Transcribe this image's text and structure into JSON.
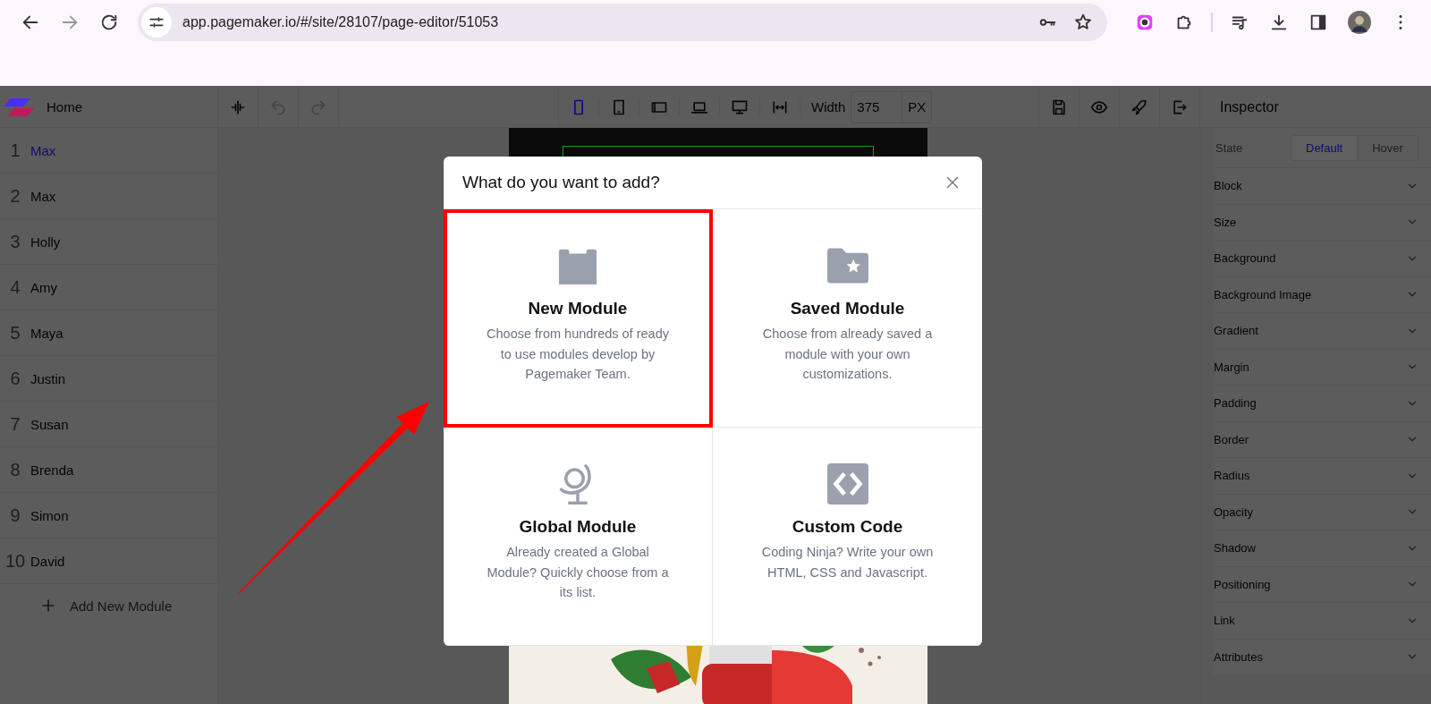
{
  "browser": {
    "nav": [
      {
        "kind": "back",
        "disabled": false
      },
      {
        "kind": "forward",
        "disabled": true
      },
      {
        "kind": "reload",
        "disabled": false
      }
    ],
    "url": "app.pagemaker.io/#/site/28107/page-editor/51053"
  },
  "toolbar": {
    "title": "Home",
    "history": [
      {
        "kind": "split",
        "disabled": false
      },
      {
        "kind": "undo",
        "disabled": true
      },
      {
        "kind": "redo",
        "disabled": true
      }
    ],
    "devices": [
      {
        "kind": "mobile",
        "selected": true
      },
      {
        "kind": "tablet",
        "selected": false
      },
      {
        "kind": "landscape",
        "selected": false
      },
      {
        "kind": "laptop",
        "selected": false
      },
      {
        "kind": "desktop",
        "selected": false
      }
    ],
    "width_label": "Width",
    "width_value": "375",
    "unit": "PX",
    "actions": [
      {
        "kind": "save"
      },
      {
        "kind": "preview"
      },
      {
        "kind": "publish"
      },
      {
        "kind": "exit"
      }
    ]
  },
  "sidebar": {
    "modules": [
      {
        "number": "1",
        "name": "Max",
        "selected": true
      },
      {
        "number": "2",
        "name": "Max",
        "selected": false
      },
      {
        "number": "3",
        "name": "Holly",
        "selected": false
      },
      {
        "number": "4",
        "name": "Amy",
        "selected": false
      },
      {
        "number": "5",
        "name": "Maya",
        "selected": false
      },
      {
        "number": "6",
        "name": "Justin",
        "selected": false
      },
      {
        "number": "7",
        "name": "Susan",
        "selected": false
      },
      {
        "number": "8",
        "name": "Brenda",
        "selected": false
      },
      {
        "number": "9",
        "name": "Simon",
        "selected": false
      },
      {
        "number": "10",
        "name": "David",
        "selected": false
      }
    ],
    "add_label": "Add New Module"
  },
  "inspector": {
    "title": "Inspector",
    "state_label": "State",
    "states": [
      {
        "label": "Default",
        "selected": true
      },
      {
        "label": "Hover",
        "selected": false
      }
    ],
    "sections": [
      "Block",
      "Size",
      "Background",
      "Background Image",
      "Gradient",
      "Margin",
      "Padding",
      "Border",
      "Radius",
      "Opacity",
      "Shadow",
      "Positioning",
      "Link",
      "Attributes"
    ]
  },
  "dialog": {
    "title": "What do you want to add?",
    "options": [
      {
        "kind": "new",
        "title": "New Module",
        "description": "Choose from hundreds of ready to use modules develop by Pagemaker Team.",
        "highlighted": true
      },
      {
        "kind": "saved",
        "title": "Saved Module",
        "description": "Choose from already saved a module with your own customizations.",
        "highlighted": false
      },
      {
        "kind": "global",
        "title": "Global Module",
        "description": "Already created a Global Module? Quickly choose from a its list.",
        "highlighted": false
      },
      {
        "kind": "code",
        "title": "Custom Code",
        "description": "Coding Ninja? Write your own HTML, CSS and Javascript.",
        "highlighted": false
      }
    ]
  }
}
